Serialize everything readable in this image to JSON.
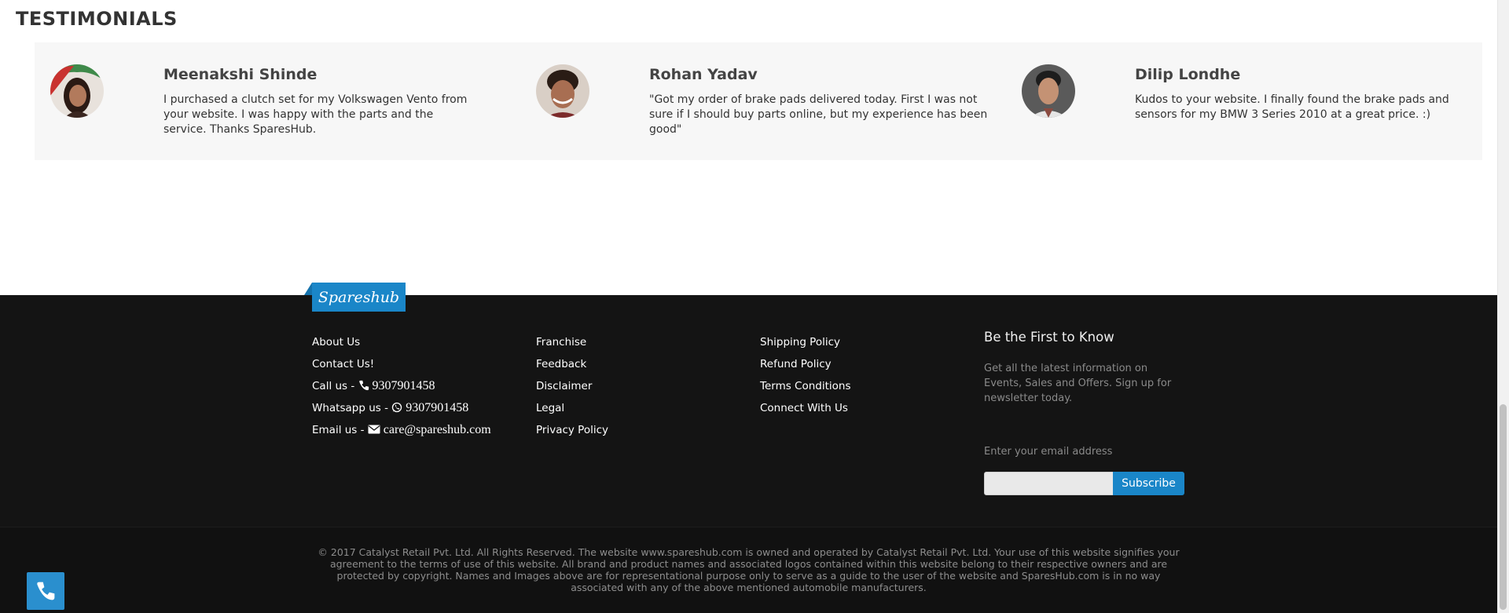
{
  "testimonials": {
    "title": "TESTIMONIALS",
    "items": [
      {
        "name": "Meenakshi Shinde",
        "text": "I purchased a clutch set for my Volkswagen Vento from your website. I was happy with the parts and the service. Thanks SparesHub."
      },
      {
        "name": "Rohan Yadav",
        "text": "\"Got my order of brake pads delivered today. First I was not sure if I should buy parts online, but my experience has been good\""
      },
      {
        "name": "Dilip Londhe",
        "text": "Kudos to your website. I finally found the brake pads and sensors for my BMW 3 Series 2010 at a great price. :)"
      }
    ]
  },
  "footer": {
    "brand": "Spareshub",
    "col1": {
      "about": "About Us",
      "contact": "Contact Us!",
      "call_label": "Call us - ",
      "call_number": "9307901458",
      "whatsapp_label": "Whatsapp us - ",
      "whatsapp_number": "9307901458",
      "email_label": "Email us - ",
      "email": "care@spareshub.com"
    },
    "col2": [
      "Franchise",
      "Feedback",
      "Disclaimer",
      "Legal",
      "Privacy Policy"
    ],
    "col3": [
      "Shipping Policy",
      "Refund Policy",
      "Terms Conditions",
      "Connect With Us"
    ],
    "newsletter": {
      "title": "Be the First to Know",
      "text": "Get all the latest information on Events, Sales and Offers. Sign up for newsletter today.",
      "label": "Enter your email address",
      "placeholder": "",
      "button": "Subscribe"
    },
    "copyright": "© 2017 Catalyst Retail Pvt. Ltd. All Rights Reserved. The website www.spareshub.com is owned and operated by Catalyst Retail Pvt. Ltd. Your use of this website signifies your agreement to the terms of use of this website. All brand and product names and associated logos contained within this website belong to their respective owners and are protected by copyright. Names and Images above are for representational purpose only to serve as a guide to the user of the website and SparesHub.com is in no way associated with any of the above mentioned automobile manufacturers."
  },
  "colors": {
    "accent": "#1a86c8",
    "footer_bg": "#141414",
    "strip_bg": "#f7f7f7"
  },
  "icons": {
    "call": "phone-icon",
    "whatsapp": "whatsapp-icon",
    "email": "envelope-icon",
    "fab": "phone-icon"
  }
}
